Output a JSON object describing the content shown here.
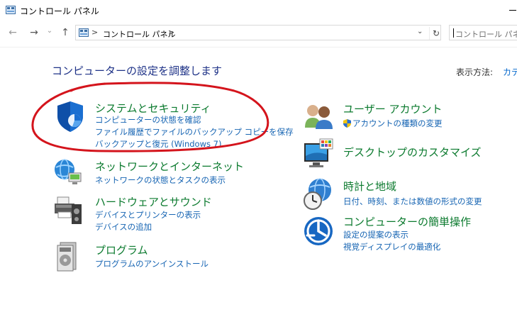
{
  "window": {
    "title": "コントロール パネル"
  },
  "navigation": {
    "back_icon": "←",
    "forward_icon": "→",
    "dropdown_icon": "⌄",
    "up_icon": "↑",
    "breadcrumb_sep": ">",
    "breadcrumb": "コントロール パネル",
    "address_dropdown": "⌄",
    "refresh_icon": "↻",
    "search_placeholder": "コントロール パネルの"
  },
  "header": {
    "title": "コンピューターの設定を調整します",
    "view_by_label": "表示方法:",
    "view_by_value": "カテ"
  },
  "left_categories": [
    {
      "title": "システムとセキュリティ",
      "links": [
        "コンピューターの状態を確認",
        "ファイル履歴でファイルのバックアップ コピーを保存",
        "バックアップと復元 (Windows 7)"
      ]
    },
    {
      "title": "ネットワークとインターネット",
      "links": [
        "ネットワークの状態とタスクの表示"
      ]
    },
    {
      "title": "ハードウェアとサウンド",
      "links": [
        "デバイスとプリンターの表示",
        "デバイスの追加"
      ]
    },
    {
      "title": "プログラム",
      "links": [
        "プログラムのアンインストール"
      ]
    }
  ],
  "right_categories": [
    {
      "title": "ユーザー アカウント",
      "links": [
        "アカウントの種類の変更"
      ]
    },
    {
      "title": "デスクトップのカスタマイズ",
      "links": []
    },
    {
      "title": "時計と地域",
      "links": [
        "日付、時刻、または数値の形式の変更"
      ]
    },
    {
      "title": "コンピューターの簡単操作",
      "links": [
        "設定の提案の表示",
        "視覚ディスプレイの最適化"
      ]
    }
  ],
  "colors": {
    "category_title": "#0b7a2e",
    "link": "#1765b3",
    "page_title": "#1e3287",
    "annotation": "#d4141c"
  },
  "icons": {
    "system_security": "shield-icon",
    "network": "network-globe-icon",
    "hardware": "printer-icon",
    "programs": "programs-disc-icon",
    "user_accounts": "users-icon",
    "appearance": "monitor-palette-icon",
    "clock_region": "clock-globe-icon",
    "ease_of_access": "ease-of-access-icon",
    "uac": "uac-shield-icon"
  }
}
